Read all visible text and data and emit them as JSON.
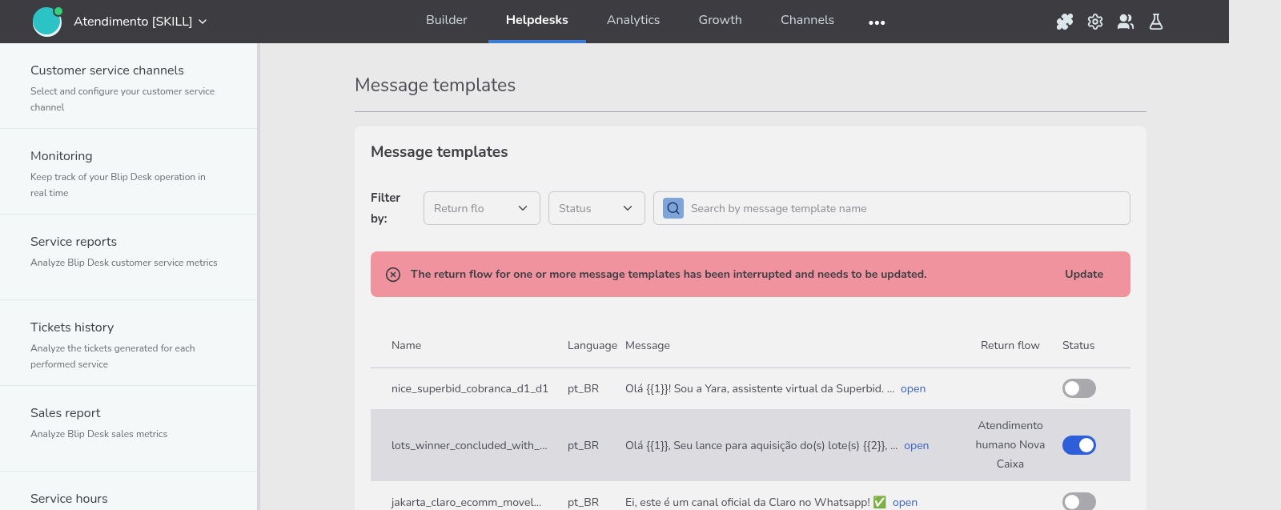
{
  "header": {
    "workspace": "Atendimento [SKILL]",
    "nav": [
      {
        "label": "Builder",
        "selected": false
      },
      {
        "label": "Helpdesks",
        "selected": true
      },
      {
        "label": "Analytics",
        "selected": false
      },
      {
        "label": "Growth",
        "selected": false
      },
      {
        "label": "Channels",
        "selected": false
      }
    ],
    "more": "•••"
  },
  "sidebar": {
    "items": [
      {
        "title": "Customer service channels",
        "description": "Select and configure your customer service channel"
      },
      {
        "title": "Monitoring",
        "description": "Keep track of your Blip Desk operation in real time"
      },
      {
        "title": "Service reports",
        "description": "Analyze Blip Desk customer service metrics"
      },
      {
        "title": "Tickets history",
        "description": "Analyze the tickets generated for each performed service"
      },
      {
        "title": "Sales report",
        "description": "Analyze Blip Desk sales metrics"
      },
      {
        "title": "Service hours"
      }
    ]
  },
  "page_title": "Message templates",
  "card": {
    "title": "Message templates",
    "filter_label": "Filter by:",
    "filters": [
      {
        "value": "Return flo"
      },
      {
        "value": "Status"
      }
    ],
    "search": {
      "placeholder": "Search by message template name"
    },
    "alert": {
      "message": "The return flow for one or more message templates has been interrupted and needs to be updated.",
      "action": "Update"
    },
    "table": {
      "columns": [
        "Name",
        "Language",
        "Message",
        "Return flow",
        "Status"
      ],
      "rows": [
        {
          "name": "nice_superbid_cobranca_d1_d1",
          "language": "pt_BR",
          "message": "Olá {{1}}! Sou a Yara, assistente virtual da Superbid. ...",
          "link": "open",
          "on": false,
          "selected": false
        },
        {
          "name": "lots_winner_concluded_with_...",
          "language": "pt_BR",
          "message": "Olá {{1}}, Seu lance para aquisição do(s) lote(s) {{2}}, ...",
          "link": "open",
          "return_flow": "Atendimento humano Nova Caixa",
          "on": true,
          "selected": true
        },
        {
          "name": "jakarta_claro_ecomm_movel...",
          "language": "pt_BR",
          "message": "Ei, este é um canal oficial da Claro no Whatsapp! ✅",
          "link": "open",
          "on": false,
          "selected": false
        }
      ]
    }
  }
}
